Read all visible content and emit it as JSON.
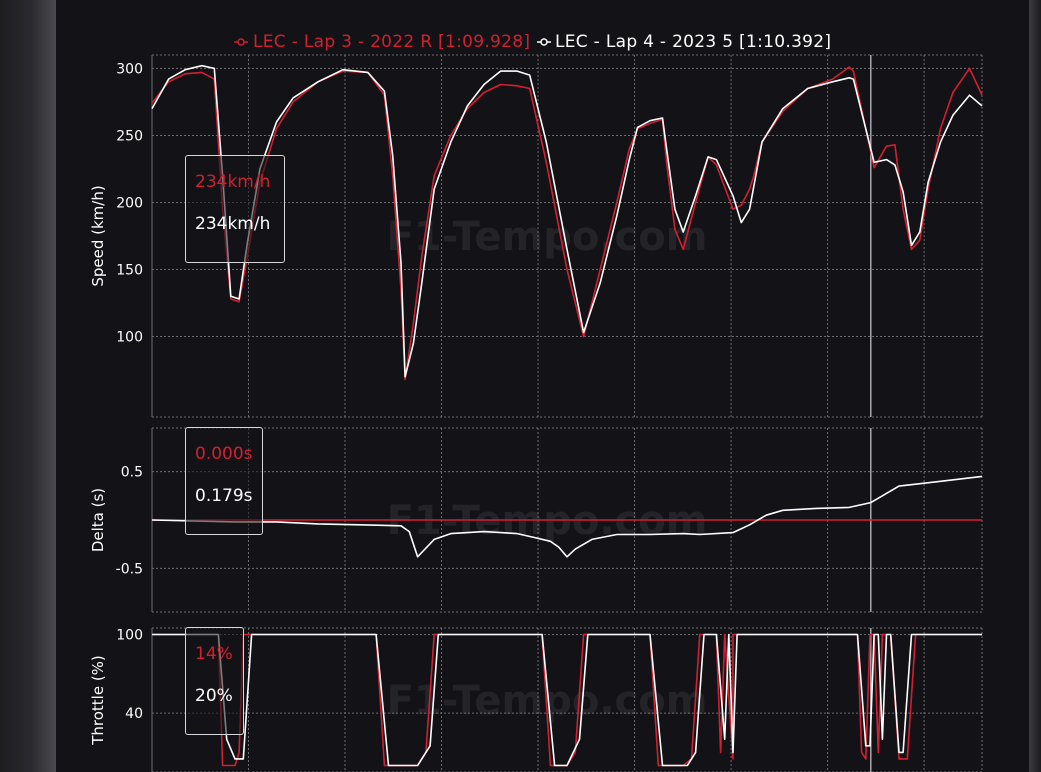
{
  "colors": {
    "lap1": "#d31f2f",
    "lap2": "#ffffff",
    "grid": "#6d6d72",
    "cursor": "#a6a6ad"
  },
  "legend": {
    "items": [
      {
        "label": "LEC - Lap 3 - 2022 R [1:09.928]",
        "color": "#d31f2f"
      },
      {
        "label": "LEC - Lap 4 - 2023 5 [1:10.392]",
        "color": "#ffffff"
      }
    ]
  },
  "watermark": "F1-Tempo.com",
  "tooltips": [
    {
      "lap1": "234km/h",
      "lap2": "234km/h"
    },
    {
      "lap1": "0.000s",
      "lap2": "0.179s"
    },
    {
      "lap1": "14%",
      "lap2": "20%"
    }
  ],
  "chart_data": [
    {
      "type": "line",
      "ylabel": "Speed (km/h)",
      "ylim": [
        40,
        310
      ],
      "yticks": [
        100,
        150,
        200,
        250,
        300
      ],
      "xlim": [
        0,
        1
      ],
      "cursor_x": 0.866,
      "grid": true,
      "series": [
        {
          "name": "LEC - Lap 3 - 2022 R [1:09.928]",
          "x": [
            0,
            0.02,
            0.04,
            0.06,
            0.075,
            0.085,
            0.095,
            0.105,
            0.115,
            0.13,
            0.15,
            0.17,
            0.2,
            0.23,
            0.26,
            0.28,
            0.29,
            0.3,
            0.305,
            0.315,
            0.325,
            0.34,
            0.36,
            0.38,
            0.4,
            0.42,
            0.44,
            0.455,
            0.475,
            0.5,
            0.52,
            0.54,
            0.56,
            0.575,
            0.585,
            0.6,
            0.615,
            0.62,
            0.63,
            0.64,
            0.655,
            0.67,
            0.68,
            0.7,
            0.71,
            0.72,
            0.725,
            0.735,
            0.76,
            0.79,
            0.82,
            0.84,
            0.845,
            0.87,
            0.885,
            0.895,
            0.905,
            0.915,
            0.925,
            0.935,
            0.95,
            0.965,
            0.985,
            1
          ],
          "y": [
            274,
            290,
            296,
            297,
            292,
            195,
            128,
            126,
            160,
            215,
            255,
            275,
            290,
            298,
            297,
            280,
            220,
            135,
            68,
            110,
            160,
            220,
            250,
            270,
            282,
            288,
            287,
            285,
            230,
            150,
            100,
            150,
            200,
            240,
            255,
            259,
            262,
            230,
            180,
            165,
            200,
            234,
            228,
            195,
            198,
            210,
            220,
            245,
            268,
            285,
            292,
            301,
            298,
            226,
            242,
            243,
            195,
            165,
            172,
            210,
            255,
            282,
            300,
            280
          ]
        },
        {
          "name": "LEC - Lap 4 - 2023 5 [1:10.392]",
          "x": [
            0,
            0.02,
            0.04,
            0.06,
            0.075,
            0.085,
            0.095,
            0.105,
            0.115,
            0.13,
            0.15,
            0.17,
            0.2,
            0.23,
            0.26,
            0.28,
            0.29,
            0.3,
            0.305,
            0.315,
            0.325,
            0.34,
            0.36,
            0.38,
            0.4,
            0.42,
            0.44,
            0.455,
            0.475,
            0.5,
            0.52,
            0.54,
            0.56,
            0.575,
            0.585,
            0.6,
            0.615,
            0.62,
            0.63,
            0.64,
            0.655,
            0.67,
            0.68,
            0.7,
            0.71,
            0.72,
            0.725,
            0.735,
            0.76,
            0.79,
            0.82,
            0.84,
            0.845,
            0.87,
            0.885,
            0.895,
            0.905,
            0.915,
            0.925,
            0.935,
            0.95,
            0.965,
            0.985,
            1
          ],
          "y": [
            270,
            292,
            299,
            302,
            300,
            220,
            130,
            128,
            170,
            225,
            260,
            278,
            290,
            299,
            297,
            283,
            235,
            155,
            70,
            95,
            140,
            210,
            245,
            272,
            288,
            298,
            298,
            295,
            245,
            165,
            103,
            140,
            190,
            232,
            256,
            261,
            263,
            240,
            195,
            178,
            205,
            234,
            232,
            205,
            185,
            195,
            212,
            245,
            270,
            285,
            290,
            293,
            292,
            230,
            232,
            228,
            208,
            168,
            178,
            215,
            245,
            265,
            280,
            272
          ]
        }
      ]
    },
    {
      "type": "line",
      "ylabel": "Delta (s)",
      "ylim": [
        -0.95,
        0.95
      ],
      "yticks": [
        -0.5,
        0.5
      ],
      "xlim": [
        0,
        1
      ],
      "cursor_x": 0.866,
      "grid": true,
      "series": [
        {
          "name": "LEC - Lap 3 - 2022 R [1:09.928]",
          "x": [
            0,
            1
          ],
          "y": [
            0,
            0
          ]
        },
        {
          "name": "LEC - Lap 4 - 2023 5 [1:10.392]",
          "x": [
            0,
            0.05,
            0.1,
            0.15,
            0.2,
            0.25,
            0.3,
            0.31,
            0.32,
            0.34,
            0.36,
            0.4,
            0.44,
            0.46,
            0.48,
            0.49,
            0.5,
            0.51,
            0.53,
            0.56,
            0.6,
            0.64,
            0.66,
            0.7,
            0.72,
            0.74,
            0.76,
            0.8,
            0.84,
            0.866,
            0.88,
            0.9,
            0.92,
            0.95,
            1
          ],
          "y": [
            0,
            -0.01,
            -0.02,
            -0.02,
            -0.04,
            -0.05,
            -0.06,
            -0.12,
            -0.38,
            -0.2,
            -0.14,
            -0.12,
            -0.14,
            -0.18,
            -0.22,
            -0.28,
            -0.38,
            -0.3,
            -0.2,
            -0.15,
            -0.15,
            -0.14,
            -0.15,
            -0.13,
            -0.05,
            0.05,
            0.1,
            0.12,
            0.13,
            0.18,
            0.25,
            0.35,
            0.37,
            0.4,
            0.45
          ]
        }
      ]
    },
    {
      "type": "line",
      "ylabel": "Throttle (%)",
      "ylim": [
        -5,
        105
      ],
      "yticks": [
        40,
        100
      ],
      "xlim": [
        0,
        1
      ],
      "cursor_x": 0.866,
      "grid": true,
      "series": [
        {
          "name": "LEC - Lap 3 - 2022 R [1:09.928]",
          "x": [
            0,
            0.08,
            0.085,
            0.1,
            0.105,
            0.11,
            0.27,
            0.28,
            0.32,
            0.33,
            0.34,
            0.47,
            0.48,
            0.5,
            0.51,
            0.52,
            0.6,
            0.61,
            0.64,
            0.65,
            0.66,
            0.68,
            0.685,
            0.69,
            0.7,
            0.7,
            0.72,
            0.73,
            0.8,
            0.85,
            0.855,
            0.86,
            0.865,
            0.87,
            0.875,
            0.88,
            0.89,
            0.9,
            0.91,
            0.92,
            0.925,
            0.93,
            1
          ],
          "y": [
            100,
            100,
            0,
            0,
            10,
            100,
            100,
            0,
            0,
            10,
            100,
            100,
            0,
            0,
            10,
            100,
            100,
            0,
            0,
            5,
            100,
            100,
            10,
            100,
            5,
            100,
            100,
            100,
            100,
            100,
            10,
            5,
            100,
            100,
            10,
            100,
            100,
            5,
            5,
            100,
            100,
            100,
            100
          ]
        },
        {
          "name": "LEC - Lap 4 - 2023 5 [1:10.392]",
          "x": [
            0,
            0.08,
            0.09,
            0.1,
            0.11,
            0.12,
            0.27,
            0.285,
            0.32,
            0.335,
            0.345,
            0.47,
            0.485,
            0.5,
            0.515,
            0.525,
            0.6,
            0.615,
            0.645,
            0.655,
            0.665,
            0.68,
            0.69,
            0.695,
            0.7,
            0.705,
            0.72,
            0.735,
            0.8,
            0.85,
            0.86,
            0.865,
            0.87,
            0.875,
            0.88,
            0.885,
            0.89,
            0.9,
            0.905,
            0.915,
            0.925,
            0.935,
            1
          ],
          "y": [
            100,
            100,
            20,
            5,
            5,
            100,
            100,
            0,
            0,
            15,
            100,
            100,
            0,
            0,
            20,
            100,
            100,
            0,
            0,
            10,
            100,
            100,
            20,
            100,
            10,
            100,
            100,
            100,
            100,
            100,
            15,
            15,
            100,
            100,
            20,
            100,
            100,
            10,
            10,
            100,
            100,
            100,
            100
          ]
        }
      ]
    }
  ]
}
